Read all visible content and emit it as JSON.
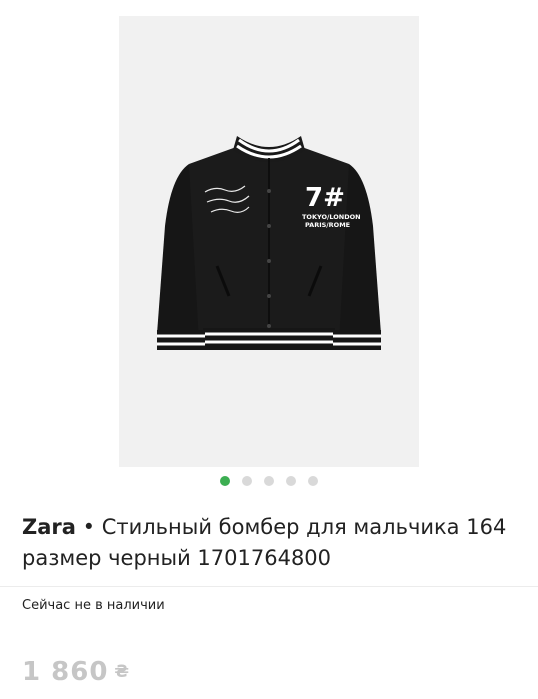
{
  "product": {
    "image_icon": "jacket-photo",
    "carousel": {
      "count": 5,
      "active_index": 0
    },
    "brand": "Zara",
    "separator": " • ",
    "title": "Стильный бомбер для мальчика 164 размер черный 1701764800",
    "availability": "Сейчас не в наличии",
    "price": "1 860",
    "currency": "₴"
  },
  "jacket_prints": {
    "patch_main": "7#",
    "patch_line1": "TOKYO/LONDON",
    "patch_line2": "PARIS/ROME"
  },
  "colors": {
    "dot_active": "#3cae52",
    "dot_inactive": "#d9d9d9",
    "price": "#c6c6c6"
  }
}
